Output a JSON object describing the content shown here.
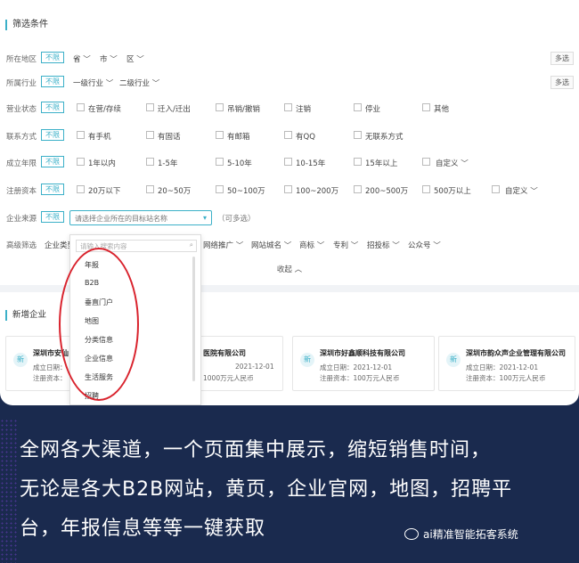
{
  "filter": {
    "title": "筛选条件",
    "unlimited": "不限",
    "multi_select": "多选",
    "region": {
      "label": "所在地区",
      "dropdowns": [
        "省",
        "市",
        "区"
      ]
    },
    "industry": {
      "label": "所属行业",
      "dropdowns": [
        "一级行业",
        "二级行业"
      ]
    },
    "status": {
      "label": "营业状态",
      "options": [
        "在营/存续",
        "迁入/迁出",
        "吊销/撤销",
        "注销",
        "停业",
        "其他"
      ]
    },
    "contact": {
      "label": "联系方式",
      "options": [
        "有手机",
        "有固话",
        "有邮箱",
        "有QQ",
        "无联系方式"
      ]
    },
    "age": {
      "label": "成立年限",
      "options": [
        "1年以内",
        "1-5年",
        "5-10年",
        "10-15年",
        "15年以上"
      ],
      "custom": "自定义"
    },
    "capital": {
      "label": "注册资本",
      "options": [
        "20万以下",
        "20~50万",
        "50~100万",
        "100~200万",
        "200~500万",
        "500万以上"
      ],
      "custom": "自定义"
    },
    "source": {
      "label": "企业来源",
      "placeholder": "请选择企业所在的目标站名称",
      "hint": "（可多选）"
    },
    "advanced": {
      "label": "高级筛选",
      "dropdowns": [
        "企业类型",
        "网络推广",
        "网站城名",
        "商标",
        "专利",
        "招投标",
        "公众号"
      ]
    },
    "collapse": "收起"
  },
  "popup": {
    "search_placeholder": "请输入搜索内容",
    "items": [
      "年报",
      "B2B",
      "垂直门户",
      "地图",
      "分类信息",
      "企业信息",
      "生活服务",
      "招聘"
    ]
  },
  "new_companies": {
    "title": "新增企业",
    "badge": "新",
    "items": [
      {
        "name": "深圳市安仙",
        "date": "成立日期：",
        "capital": "注册资本："
      },
      {
        "name": "医院有限公司",
        "date": "2021-12-01",
        "capital": "1000万元人民币"
      },
      {
        "name": "深圳市好鑫顺科技有限公司",
        "date": "成立日期：2021-12-01",
        "capital": "注册资本：100万元人民币"
      },
      {
        "name": "深圳市韵众声企业管理有限公司",
        "date": "成立日期：2021-12-01",
        "capital": "注册资本：100万元人民币"
      }
    ]
  },
  "caption": {
    "lines": [
      "全网各大渠道，一个页面集中展示，缩短销售时间，",
      "无论是各大B2B网站，黄页，企业官网，地图，招聘平",
      "台，年报信息等等一键获取"
    ]
  },
  "brand": "ai精准智能拓客系统",
  "colors": {
    "accent": "#3bb0c8",
    "highlight": "#d9232d",
    "background": "#1a2a4e"
  }
}
